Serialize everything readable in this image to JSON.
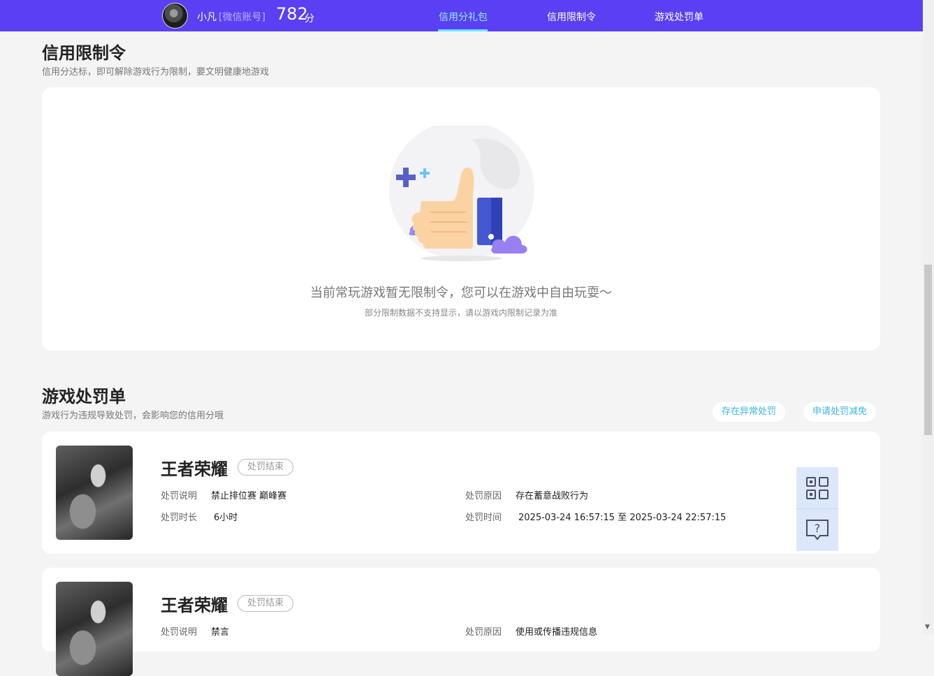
{
  "header": {
    "username": "小凡",
    "account_type": "[微信账号]",
    "score": "782",
    "score_unit": "分",
    "nav": [
      {
        "label": "信用分礼包",
        "active": true
      },
      {
        "label": "信用限制令",
        "active": false
      },
      {
        "label": "游戏处罚单",
        "active": false
      }
    ]
  },
  "restrictions": {
    "title": "信用限制令",
    "description": "信用分达标，即可解除游戏行为限制，要文明健康地游戏",
    "empty_title": "当前常玩游戏暂无限制令，您可以在游戏中自由玩耍～",
    "empty_note": "部分限制数据不支持显示，请以游戏内限制记录为准"
  },
  "penalties": {
    "title": "游戏处罚单",
    "description": "游戏行为违规导致处罚，会影响您的信用分哦",
    "actions": [
      "存在异常处罚",
      "申请处罚减免"
    ],
    "labels": {
      "explanation": "处罚说明",
      "duration": "处罚时长",
      "reason": "处罚原因",
      "time": "处罚时间"
    },
    "items": [
      {
        "game": "王者荣耀",
        "status": "处罚结束",
        "explanation": "禁止排位赛 巅峰赛",
        "duration": "6小时",
        "reason": "存在蓄意战败行为",
        "time": "2025-03-24 16:57:15 至 2025-03-24 22:57:15"
      },
      {
        "game": "王者荣耀",
        "status": "处罚结束",
        "explanation": "禁言",
        "reason": "使用或传播违规信息"
      }
    ]
  },
  "icons": {
    "qr": "qr-code-icon",
    "help": "help-bubble-icon",
    "art": "thumbs-up-illustration"
  },
  "colors": {
    "header_bg": "#5b3ff3",
    "active_nav": "#8df1ff",
    "link": "#38b6e6",
    "tool_bg": "#dce7fb"
  }
}
